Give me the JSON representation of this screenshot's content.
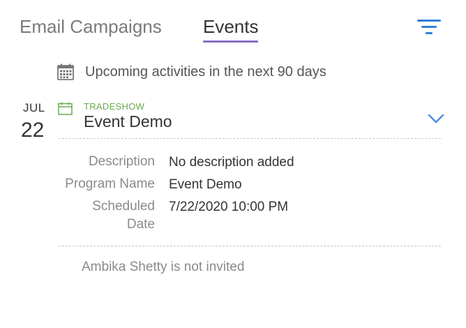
{
  "tabs": [
    {
      "label": "Email Campaigns",
      "active": false
    },
    {
      "label": "Events",
      "active": true
    }
  ],
  "filter_icon": "filter-icon",
  "upcoming": {
    "icon": "calendar-grid-icon",
    "text": "Upcoming activities in the next 90 days"
  },
  "event": {
    "month": "JUL",
    "day": "22",
    "icon": "calendar-icon",
    "type": "TRADESHOW",
    "title": "Event Demo",
    "expand_icon": "chevron-down-icon",
    "details": [
      {
        "label": "Description",
        "value": "No description added"
      },
      {
        "label": "Program Name",
        "value": "Event Demo"
      },
      {
        "label": "Scheduled",
        "label2": "Date",
        "value": "7/22/2020 10:00 PM"
      }
    ],
    "invite_status": "Ambika Shetty is not invited"
  },
  "colors": {
    "accent_underline": "#8b6bbf",
    "filter_blue": "#2f7fd6",
    "tradeshow_green": "#6aa84f"
  }
}
